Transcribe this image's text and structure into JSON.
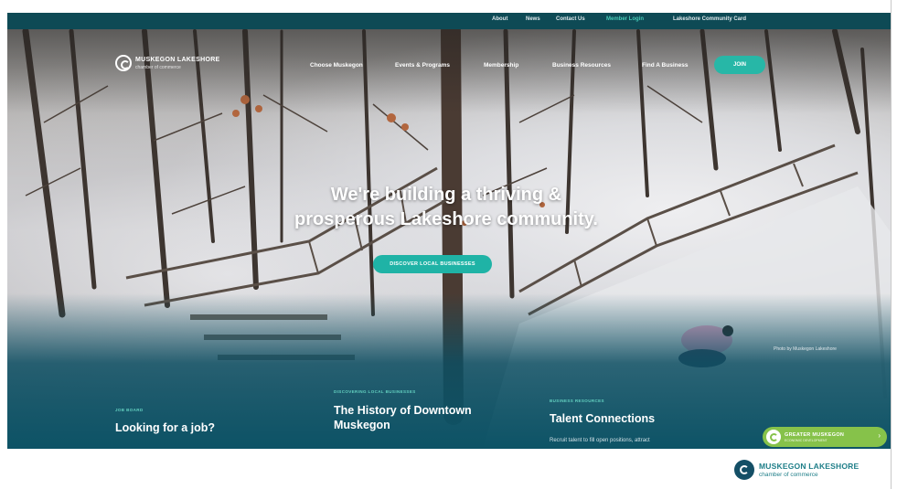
{
  "utility_nav": {
    "items": [
      {
        "label": "About"
      },
      {
        "label": "News"
      },
      {
        "label": "Contact Us"
      },
      {
        "label": "Member Login"
      },
      {
        "label": "Lakeshore Community Card"
      }
    ]
  },
  "logo": {
    "name": "MUSKEGON LAKESHORE",
    "subtitle": "chamber of commerce"
  },
  "main_nav": {
    "items": [
      {
        "label": "Choose Muskegon"
      },
      {
        "label": "Events & Programs"
      },
      {
        "label": "Membership"
      },
      {
        "label": "Business Resources"
      },
      {
        "label": "Find A Business"
      }
    ],
    "join_label": "JOIN"
  },
  "hero": {
    "title_line1": "We're building a thriving &",
    "title_line2": "prosperous Lakeshore community.",
    "cta_label": "DISCOVER LOCAL BUSINESSES",
    "photo_credit": "Photo by Muskegon Lakeshore"
  },
  "cards": [
    {
      "kicker": "JOB BOARD",
      "title": "Looking for a job?",
      "description": ""
    },
    {
      "kicker": "DISCOVERING LOCAL BUSINESSES",
      "title": "The History of Downtown Muskegon",
      "description": ""
    },
    {
      "kicker": "BUSINESS RESOURCES",
      "title": "Talent Connections",
      "description": "Recruit talent to fill open positions, attract"
    }
  ],
  "widget": {
    "label": "GREATER MUSKEGON",
    "sublabel": "ECONOMIC DEVELOPMENT"
  },
  "footer_logo": {
    "name": "MUSKEGON LAKESHORE",
    "subtitle": "chamber of commerce"
  },
  "colors": {
    "teal_bar": "#0e4a55",
    "accent_teal": "#27b7a7",
    "widget_green": "#86c24a",
    "footer_teal": "#1e7e88"
  }
}
